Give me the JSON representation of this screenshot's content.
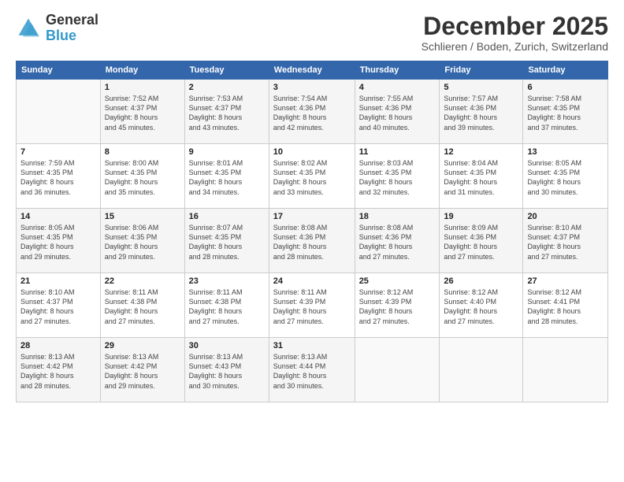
{
  "header": {
    "logo_general": "General",
    "logo_blue": "Blue",
    "title": "December 2025",
    "location": "Schlieren / Boden, Zurich, Switzerland"
  },
  "weekdays": [
    "Sunday",
    "Monday",
    "Tuesday",
    "Wednesday",
    "Thursday",
    "Friday",
    "Saturday"
  ],
  "weeks": [
    [
      {
        "day": "",
        "info": ""
      },
      {
        "day": "1",
        "info": "Sunrise: 7:52 AM\nSunset: 4:37 PM\nDaylight: 8 hours\nand 45 minutes."
      },
      {
        "day": "2",
        "info": "Sunrise: 7:53 AM\nSunset: 4:37 PM\nDaylight: 8 hours\nand 43 minutes."
      },
      {
        "day": "3",
        "info": "Sunrise: 7:54 AM\nSunset: 4:36 PM\nDaylight: 8 hours\nand 42 minutes."
      },
      {
        "day": "4",
        "info": "Sunrise: 7:55 AM\nSunset: 4:36 PM\nDaylight: 8 hours\nand 40 minutes."
      },
      {
        "day": "5",
        "info": "Sunrise: 7:57 AM\nSunset: 4:36 PM\nDaylight: 8 hours\nand 39 minutes."
      },
      {
        "day": "6",
        "info": "Sunrise: 7:58 AM\nSunset: 4:35 PM\nDaylight: 8 hours\nand 37 minutes."
      }
    ],
    [
      {
        "day": "7",
        "info": "Sunrise: 7:59 AM\nSunset: 4:35 PM\nDaylight: 8 hours\nand 36 minutes."
      },
      {
        "day": "8",
        "info": "Sunrise: 8:00 AM\nSunset: 4:35 PM\nDaylight: 8 hours\nand 35 minutes."
      },
      {
        "day": "9",
        "info": "Sunrise: 8:01 AM\nSunset: 4:35 PM\nDaylight: 8 hours\nand 34 minutes."
      },
      {
        "day": "10",
        "info": "Sunrise: 8:02 AM\nSunset: 4:35 PM\nDaylight: 8 hours\nand 33 minutes."
      },
      {
        "day": "11",
        "info": "Sunrise: 8:03 AM\nSunset: 4:35 PM\nDaylight: 8 hours\nand 32 minutes."
      },
      {
        "day": "12",
        "info": "Sunrise: 8:04 AM\nSunset: 4:35 PM\nDaylight: 8 hours\nand 31 minutes."
      },
      {
        "day": "13",
        "info": "Sunrise: 8:05 AM\nSunset: 4:35 PM\nDaylight: 8 hours\nand 30 minutes."
      }
    ],
    [
      {
        "day": "14",
        "info": "Sunrise: 8:05 AM\nSunset: 4:35 PM\nDaylight: 8 hours\nand 29 minutes."
      },
      {
        "day": "15",
        "info": "Sunrise: 8:06 AM\nSunset: 4:35 PM\nDaylight: 8 hours\nand 29 minutes."
      },
      {
        "day": "16",
        "info": "Sunrise: 8:07 AM\nSunset: 4:35 PM\nDaylight: 8 hours\nand 28 minutes."
      },
      {
        "day": "17",
        "info": "Sunrise: 8:08 AM\nSunset: 4:36 PM\nDaylight: 8 hours\nand 28 minutes."
      },
      {
        "day": "18",
        "info": "Sunrise: 8:08 AM\nSunset: 4:36 PM\nDaylight: 8 hours\nand 27 minutes."
      },
      {
        "day": "19",
        "info": "Sunrise: 8:09 AM\nSunset: 4:36 PM\nDaylight: 8 hours\nand 27 minutes."
      },
      {
        "day": "20",
        "info": "Sunrise: 8:10 AM\nSunset: 4:37 PM\nDaylight: 8 hours\nand 27 minutes."
      }
    ],
    [
      {
        "day": "21",
        "info": "Sunrise: 8:10 AM\nSunset: 4:37 PM\nDaylight: 8 hours\nand 27 minutes."
      },
      {
        "day": "22",
        "info": "Sunrise: 8:11 AM\nSunset: 4:38 PM\nDaylight: 8 hours\nand 27 minutes."
      },
      {
        "day": "23",
        "info": "Sunrise: 8:11 AM\nSunset: 4:38 PM\nDaylight: 8 hours\nand 27 minutes."
      },
      {
        "day": "24",
        "info": "Sunrise: 8:11 AM\nSunset: 4:39 PM\nDaylight: 8 hours\nand 27 minutes."
      },
      {
        "day": "25",
        "info": "Sunrise: 8:12 AM\nSunset: 4:39 PM\nDaylight: 8 hours\nand 27 minutes."
      },
      {
        "day": "26",
        "info": "Sunrise: 8:12 AM\nSunset: 4:40 PM\nDaylight: 8 hours\nand 27 minutes."
      },
      {
        "day": "27",
        "info": "Sunrise: 8:12 AM\nSunset: 4:41 PM\nDaylight: 8 hours\nand 28 minutes."
      }
    ],
    [
      {
        "day": "28",
        "info": "Sunrise: 8:13 AM\nSunset: 4:42 PM\nDaylight: 8 hours\nand 28 minutes."
      },
      {
        "day": "29",
        "info": "Sunrise: 8:13 AM\nSunset: 4:42 PM\nDaylight: 8 hours\nand 29 minutes."
      },
      {
        "day": "30",
        "info": "Sunrise: 8:13 AM\nSunset: 4:43 PM\nDaylight: 8 hours\nand 30 minutes."
      },
      {
        "day": "31",
        "info": "Sunrise: 8:13 AM\nSunset: 4:44 PM\nDaylight: 8 hours\nand 30 minutes."
      },
      {
        "day": "",
        "info": ""
      },
      {
        "day": "",
        "info": ""
      },
      {
        "day": "",
        "info": ""
      }
    ]
  ]
}
